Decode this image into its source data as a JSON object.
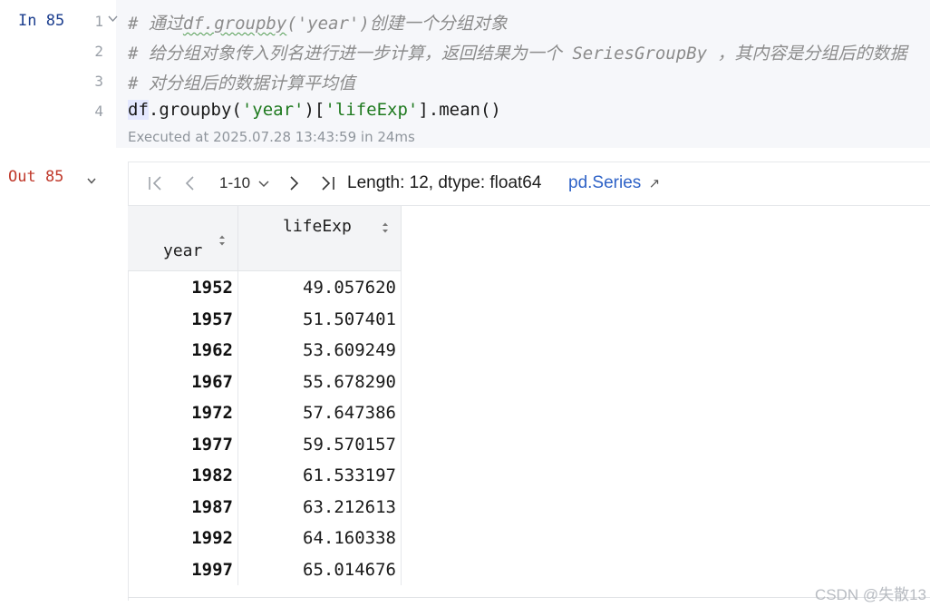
{
  "input_cell": {
    "label": "In 85",
    "lines": [
      {
        "num": "1",
        "parts": [
          {
            "text": "# 通过",
            "cls": "comment"
          },
          {
            "text": "df.groupby",
            "cls": "comment squiggle"
          },
          {
            "text": "('year')创建一个分组对象",
            "cls": "comment"
          }
        ]
      },
      {
        "num": "2",
        "parts": [
          {
            "text": "# 给分组对象传入列名进行进一步计算，返回结果为一个 SeriesGroupBy ，其内容是分组后的数据",
            "cls": "comment"
          }
        ]
      },
      {
        "num": "3",
        "parts": [
          {
            "text": "# 对分组后的数据计算平均值",
            "cls": "comment"
          }
        ]
      },
      {
        "num": "4",
        "parts": [
          {
            "text": "df",
            "cls": "cursorbox"
          },
          {
            "text": ".groupby(",
            "cls": ""
          },
          {
            "text": "'year'",
            "cls": "str"
          },
          {
            "text": ")[",
            "cls": ""
          },
          {
            "text": "'lifeExp'",
            "cls": "str"
          },
          {
            "text": "].mean()",
            "cls": ""
          }
        ]
      }
    ],
    "executed": "Executed at 2025.07.28 13:43:59 in 24ms"
  },
  "output_cell": {
    "label": "Out 85",
    "toolbar": {
      "page_range": "1-10",
      "length_text": "Length: 12, dtype: float64",
      "type_link": "pd.Series",
      "link_arrow": "↗"
    },
    "table": {
      "index_header": "year",
      "value_header": "lifeExp",
      "rows": [
        {
          "year": "1952",
          "value": "49.057620"
        },
        {
          "year": "1957",
          "value": "51.507401"
        },
        {
          "year": "1962",
          "value": "53.609249"
        },
        {
          "year": "1967",
          "value": "55.678290"
        },
        {
          "year": "1972",
          "value": "57.647386"
        },
        {
          "year": "1977",
          "value": "59.570157"
        },
        {
          "year": "1982",
          "value": "61.533197"
        },
        {
          "year": "1987",
          "value": "63.212613"
        },
        {
          "year": "1992",
          "value": "64.160338"
        },
        {
          "year": "1997",
          "value": "65.014676"
        }
      ]
    }
  },
  "watermark": "CSDN @失散13"
}
